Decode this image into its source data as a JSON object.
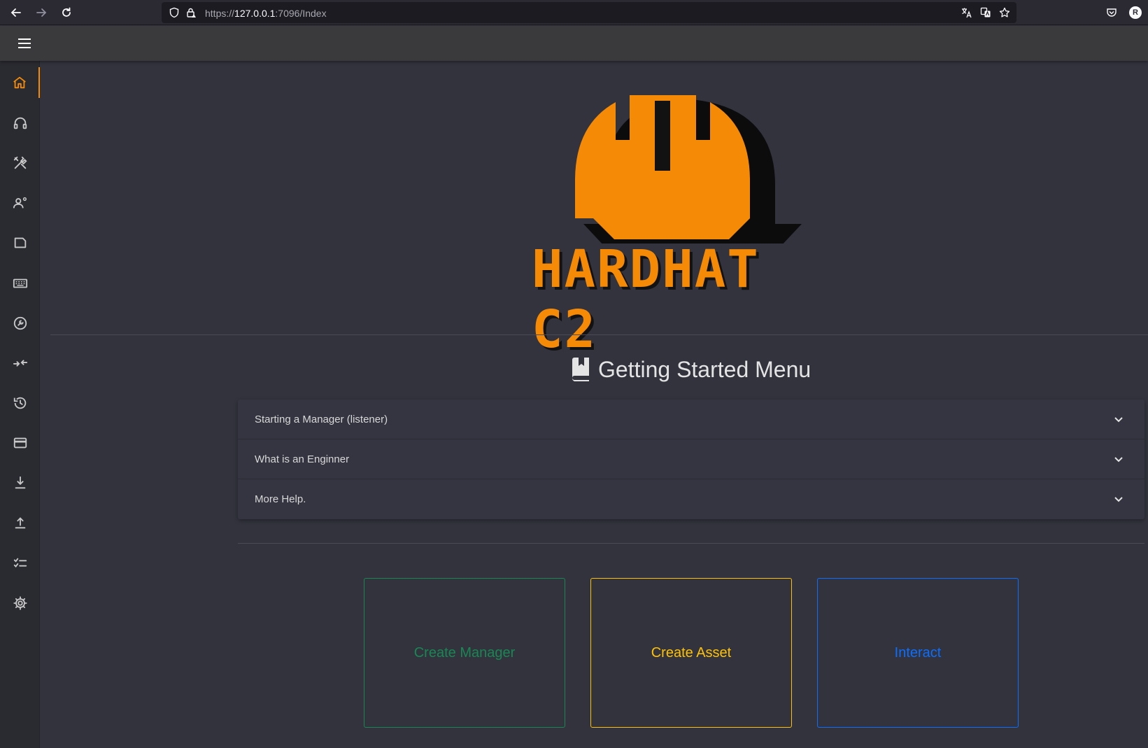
{
  "browser": {
    "url_prefix": "https://",
    "url_host": "127.0.0.1",
    "url_rest": ":7096/Index",
    "profile_initial": "R"
  },
  "sidebar": {
    "items": [
      {
        "name": "home-icon",
        "active": true
      },
      {
        "name": "headphones-icon",
        "active": false
      },
      {
        "name": "tools-icon",
        "active": false
      },
      {
        "name": "user-gear-icon",
        "active": false
      },
      {
        "name": "file-icon",
        "active": false
      },
      {
        "name": "keyboard-icon",
        "active": false
      },
      {
        "name": "wrench-circle-icon",
        "active": false
      },
      {
        "name": "arrows-compress-icon",
        "active": false
      },
      {
        "name": "history-icon",
        "active": false
      },
      {
        "name": "credit-card-icon",
        "active": false
      },
      {
        "name": "download-icon",
        "active": false
      },
      {
        "name": "upload-icon",
        "active": false
      },
      {
        "name": "checklist-icon",
        "active": false
      },
      {
        "name": "gear-icon",
        "active": false
      }
    ]
  },
  "logo": {
    "text": "HARDHAT C2"
  },
  "getting_started": {
    "title": "Getting Started Menu",
    "items": [
      {
        "label": "Starting a Manager (listener)"
      },
      {
        "label": "What is an Enginner"
      },
      {
        "label": "More Help."
      }
    ]
  },
  "actions": [
    {
      "label": "Create Manager",
      "color": "#198754"
    },
    {
      "label": "Create Asset",
      "color": "#ffc107"
    },
    {
      "label": "Interact",
      "color": "#0d6efd"
    }
  ],
  "colors": {
    "accent": "#f58a07",
    "background": "#32333d",
    "sidebar": "#2a2b31"
  }
}
